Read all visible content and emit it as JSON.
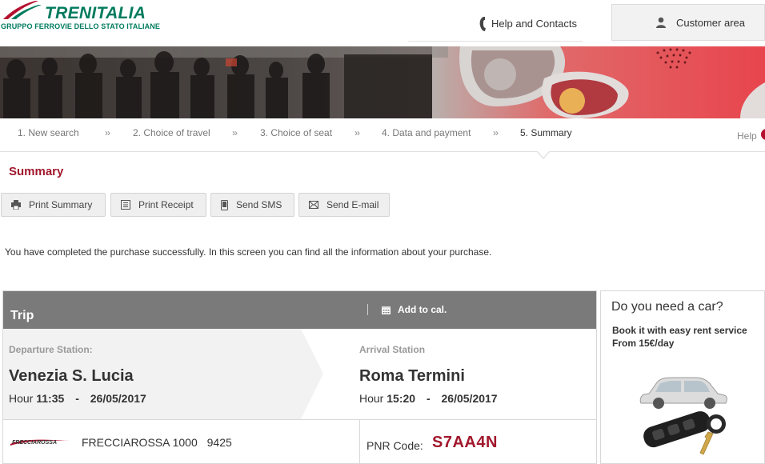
{
  "header": {
    "brand": "TRENITALIA",
    "brand_sub": "GRUPPO FERROVIE DELLO STATO ITALIANE",
    "help_contacts": "Help and Contacts",
    "customer_area": "Customer area"
  },
  "steps": [
    {
      "label": "1. New search"
    },
    {
      "label": "2. Choice of travel"
    },
    {
      "label": "3. Choice of seat"
    },
    {
      "label": "4. Data and payment"
    },
    {
      "label": "5. Summary"
    }
  ],
  "step_separator": "››",
  "help": "Help",
  "summary": {
    "title": "Summary",
    "actions": {
      "print_summary": "Print Summary",
      "print_receipt": "Print Receipt",
      "send_sms": "Send SMS",
      "send_email": "Send E-mail"
    },
    "message": "You have completed the purchase successfully. In this screen you can find all the information about your purchase."
  },
  "trip": {
    "title": "Trip",
    "add_to_cal": "Add to cal.",
    "departure": {
      "label": "Departure Station:",
      "name": "Venezia S. Lucia",
      "hour_label": "Hour",
      "time": "11:35",
      "date_sep": "-",
      "date": "26/05/2017"
    },
    "arrival": {
      "label": "Arrival Station",
      "name": "Roma Termini",
      "hour_label": "Hour",
      "time": "15:20",
      "date_sep": "-",
      "date": "26/05/2017"
    },
    "train_logo_text": "FRECCIAROSSA",
    "train_name": "FRECCIAROSSA 1000",
    "train_number": "9425",
    "pnr_label": "PNR Code:",
    "pnr_code": "S7AA4N"
  },
  "car": {
    "title": "Do you need a car?",
    "line1": "Book it with easy rent service",
    "line2": "From 15€/day"
  },
  "colors": {
    "brand_green": "#007b5e",
    "accent_red": "#a1172c",
    "trip_header": "#7a7a7a"
  }
}
